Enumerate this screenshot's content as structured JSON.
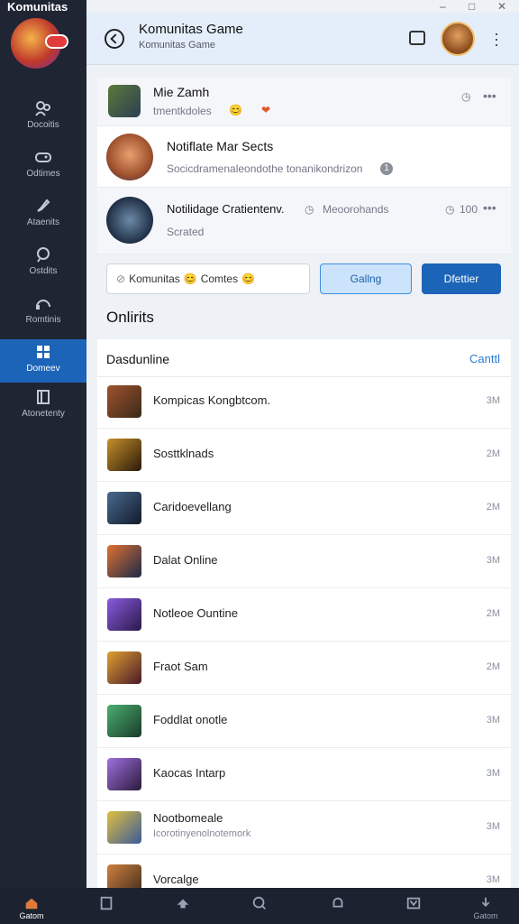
{
  "app": {
    "title": "Komunitas"
  },
  "window_controls": [
    "–",
    "□",
    "✕"
  ],
  "sidebar": {
    "items": [
      {
        "label": "Docoitis",
        "icon": "groups-icon"
      },
      {
        "label": "Odtimes",
        "icon": "gamepad-icon"
      },
      {
        "label": "Ataenits",
        "icon": "rocket-icon"
      },
      {
        "label": "Ostdits",
        "icon": "chat-icon"
      },
      {
        "label": "Romtinis",
        "icon": "headset-icon"
      },
      {
        "label": "Domeev",
        "icon": "grid-icon",
        "active": true
      },
      {
        "label": "Atonetenty",
        "icon": "book-icon"
      }
    ]
  },
  "header": {
    "title": "Komunitas Game",
    "subtitle": "Komunitas Game"
  },
  "feed": [
    {
      "title": "Mie Zamh",
      "sub": "tmentkdoles",
      "emoji": "😊",
      "heart": "❤"
    },
    {
      "title": "Notiflate Mar Sects",
      "sub": "Socicdramenaleondothe tonanikondrizon",
      "badge_num": "1"
    },
    {
      "title": "Notilidage Cratientenv.",
      "meta": "Meoorohands",
      "count": "100",
      "sub": "Scrated"
    }
  ],
  "actions": {
    "input_text": "Komunitas",
    "input_mid": "Comtes",
    "secondary": "Gallng",
    "primary": "Dfettier"
  },
  "section_title": "Onlirits",
  "list": {
    "title": "Dasdunline",
    "action": "Canttl",
    "rows": [
      {
        "name": "Kompicas Kongbtcom.",
        "time": "3M"
      },
      {
        "name": "Sosttklnads",
        "time": "2M"
      },
      {
        "name": "Caridoevellang",
        "time": "2M"
      },
      {
        "name": "Dalat Online",
        "time": "3M"
      },
      {
        "name": "Notleoe Ountine",
        "time": "2M"
      },
      {
        "name": "Fraot Sam",
        "time": "2M"
      },
      {
        "name": "Foddlat onotle",
        "time": "3M"
      },
      {
        "name": "Kaocas Intarp",
        "time": "3M"
      },
      {
        "name": "Nootbomeale",
        "sub": "Icorotinyenolnotemork",
        "time": "3M"
      },
      {
        "name": "Vorcalge",
        "time": "3M"
      }
    ]
  },
  "bottom_tabs": [
    {
      "label": "Gatom",
      "icon": "home-icon"
    },
    {
      "label": "",
      "icon": "cards-icon"
    },
    {
      "label": "",
      "icon": "share-icon"
    },
    {
      "label": "",
      "icon": "search-icon"
    },
    {
      "label": "",
      "icon": "bell-icon"
    },
    {
      "label": "",
      "icon": "inbox-icon"
    },
    {
      "label": "Gatom",
      "icon": "download-icon"
    }
  ]
}
